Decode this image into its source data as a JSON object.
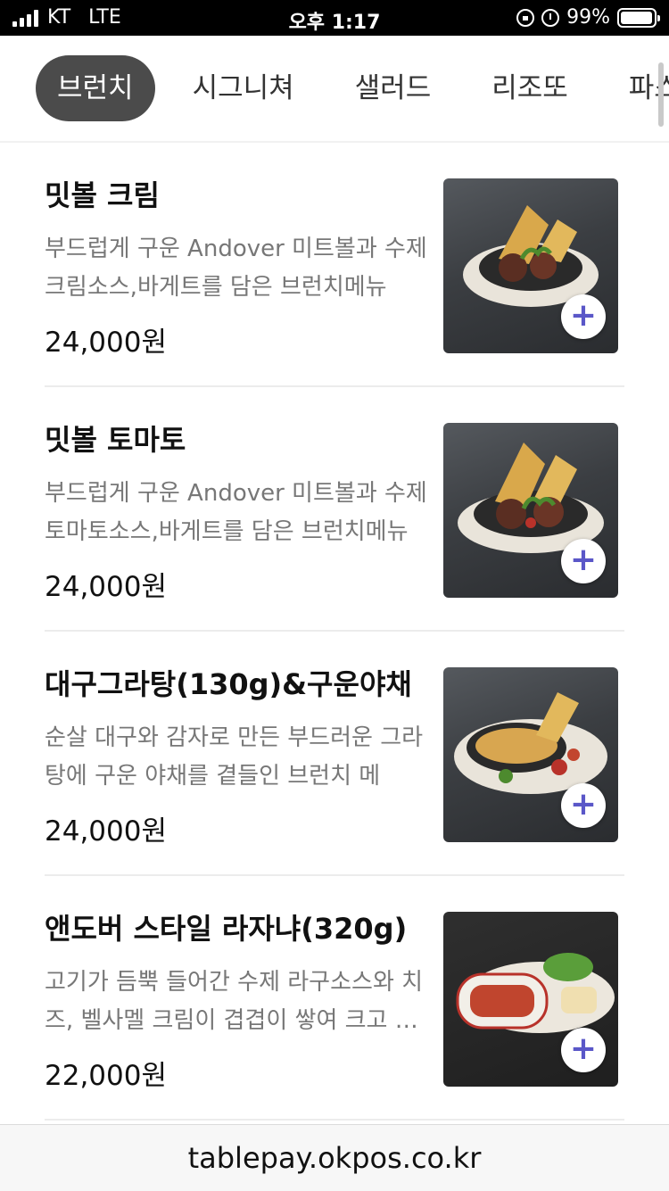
{
  "status_bar": {
    "carrier": "KT",
    "network": "LTE",
    "time": "오후 1:17",
    "battery_percent": "99%"
  },
  "tabs": [
    {
      "label": "브런치",
      "active": true
    },
    {
      "label": "시그니쳐",
      "active": false
    },
    {
      "label": "샐러드",
      "active": false
    },
    {
      "label": "리조또",
      "active": false
    },
    {
      "label": "파스타",
      "active": false
    }
  ],
  "menu_items": [
    {
      "name": "밋볼 크림",
      "description": "부드럽게 구운 Andover 미트볼과 수제크림소스,바게트를 담은 브런치메뉴",
      "price": "24,000원",
      "add_label": "+"
    },
    {
      "name": "밋볼 토마토",
      "description": "부드럽게 구운 Andover 미트볼과 수제토마토소스,바게트를 담은 브런치메뉴",
      "price": "24,000원",
      "add_label": "+"
    },
    {
      "name": "대구그라탕(130g)&구운야채",
      "description": "순살 대구와 감자로 만든 부드러운 그라탕에 구운 야채를 곁들인 브런치 메",
      "price": "24,000원",
      "add_label": "+"
    },
    {
      "name": "앤도버 스타일 라자냐(320g)",
      "description": "고기가 듬뿍 들어간 수제 라구소스와 치즈, 벨사멜 크림이 겹겹이 쌓여 크고 풍성한",
      "price": "22,000원",
      "add_label": "+"
    }
  ],
  "url_bar": {
    "url": "tablepay.okpos.co.kr"
  },
  "colors": {
    "active_tab_bg": "#4b4b4b",
    "add_button_plus": "#5a57c8",
    "description_text": "#777777"
  }
}
